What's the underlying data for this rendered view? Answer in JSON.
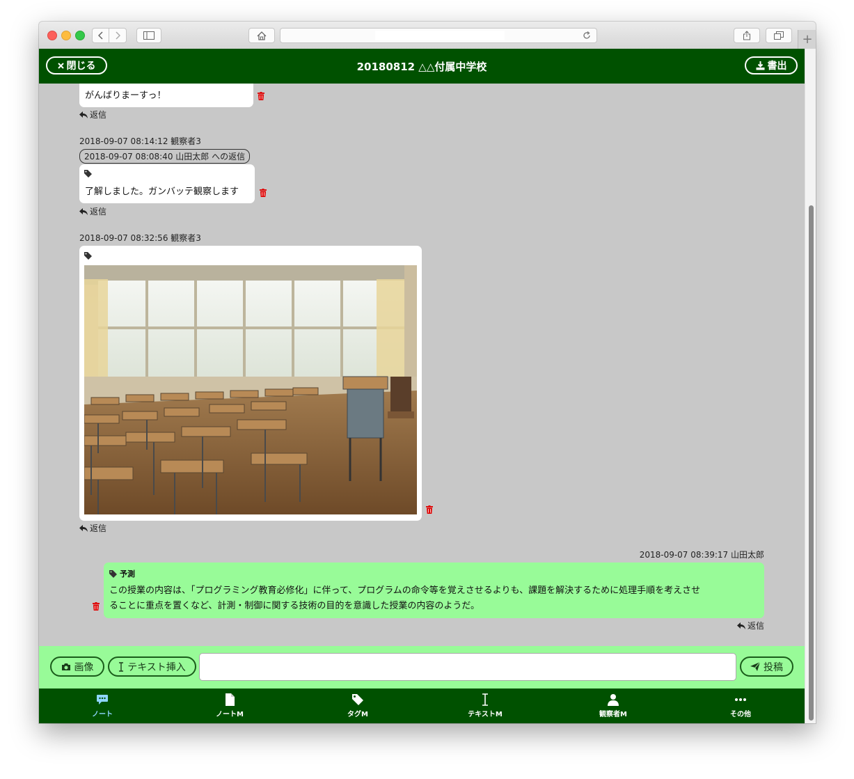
{
  "header": {
    "close_label": "閉じる",
    "title": "20180812 △△付属中学校",
    "export_label": "書出"
  },
  "messages": [
    {
      "text": "がんばりまーすっ！",
      "reply_label": "返信"
    },
    {
      "timestamp": "2018-09-07 08:14:12",
      "author": "観察者3",
      "reply_to": "2018-09-07 08:08:40 山田太郎 への返信",
      "text": "了解しました。ガンバッテ観察します",
      "reply_label": "返信"
    },
    {
      "timestamp": "2018-09-07 08:32:56",
      "author": "観察者3",
      "reply_label": "返信"
    },
    {
      "timestamp": "2018-09-07 08:39:17",
      "author": "山田太郎",
      "tag": "予測",
      "text_line1": "この授業の内容は、「プログラミング教育必修化」に伴って、プログラムの命令等を覚えさせるよりも、課題を解決するために処理手順を考えさせ",
      "text_line2": "ることに重点を置くなど、計測・制御に関する技術の目的を意識した授業の内容のようだ。",
      "reply_label": "返信"
    }
  ],
  "composer": {
    "image_label": "画像",
    "insert_text_label": "テキスト挿入",
    "input_value": "",
    "post_label": "投稿"
  },
  "bottom_nav": [
    {
      "label": "ノート",
      "icon": "comments-icon",
      "active": true
    },
    {
      "label": "ノートM",
      "icon": "file-icon"
    },
    {
      "label": "タグM",
      "icon": "tag-icon"
    },
    {
      "label": "テキストM",
      "icon": "text-cursor-icon"
    },
    {
      "label": "観察者M",
      "icon": "user-icon"
    },
    {
      "label": "その他",
      "icon": "ellipsis-icon"
    }
  ],
  "colors": {
    "header": "#005100",
    "composer": "#98fb98",
    "own_bubble": "#98fb98",
    "other_bubble": "#ffffff",
    "active_nav": "#8fd6ff",
    "trash": "#e00000"
  }
}
